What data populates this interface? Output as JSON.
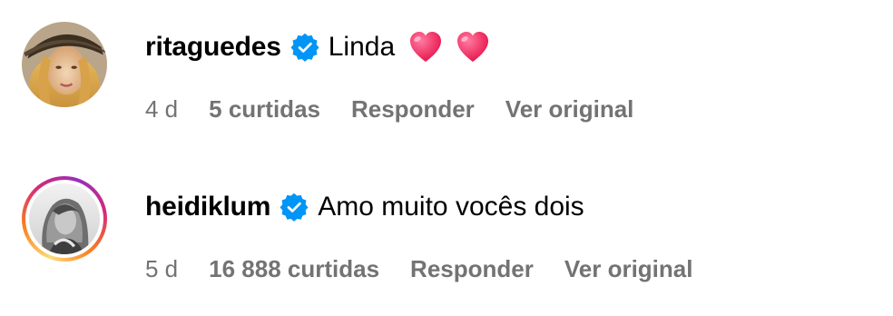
{
  "comments": [
    {
      "username": "ritaguedes",
      "text": "Linda",
      "emoji": [
        "heart-emoji",
        "heart-emoji"
      ],
      "time": "4 d",
      "likes": "5 curtidas",
      "reply": "Responder",
      "see_original": "Ver original",
      "story_ring": false
    },
    {
      "username": "heidiklum",
      "text": "Amo muito vocês dois",
      "time": "5 d",
      "likes": "16 888 curtidas",
      "reply": "Responder",
      "see_original": "Ver original",
      "story_ring": true
    }
  ],
  "colors": {
    "verified_blue": "#0095f6",
    "meta_gray": "#737373",
    "heart_pink": "#f0346a"
  }
}
